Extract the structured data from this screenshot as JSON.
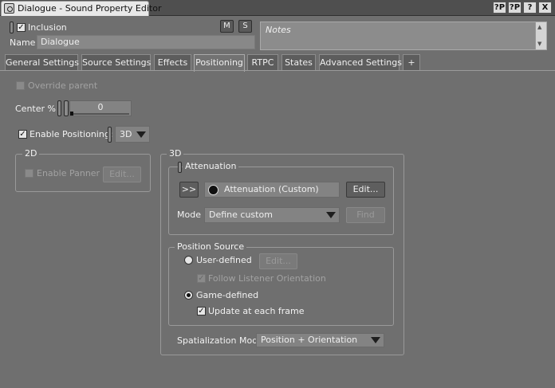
{
  "window": {
    "title": "Dialogue - Sound Property Editor",
    "controls": [
      "?P",
      "?P",
      "?",
      "X"
    ]
  },
  "header": {
    "inclusion_label": "Inclusion",
    "inclusion_checked": true,
    "mute_label": "M",
    "solo_label": "S",
    "name_label": "Name",
    "name_value": "Dialogue",
    "notes_placeholder": "Notes"
  },
  "tabs": [
    {
      "label": "General Settings",
      "active": false
    },
    {
      "label": "Source Settings",
      "active": false
    },
    {
      "label": "Effects",
      "active": false
    },
    {
      "label": "Positioning",
      "active": true
    },
    {
      "label": "RTPC",
      "active": false
    },
    {
      "label": "States",
      "active": false
    },
    {
      "label": "Advanced Settings",
      "active": false
    },
    {
      "label": "+",
      "active": false
    }
  ],
  "positioning": {
    "override_parent_label": "Override parent",
    "center_label": "Center %",
    "center_value": "0",
    "enable_positioning_label": "Enable Positioning:",
    "enable_positioning_checked": true,
    "mode_value": "3D",
    "group_2d": {
      "title": "2D",
      "enable_panner_label": "Enable Panner",
      "edit_label": "Edit..."
    },
    "group_3d": {
      "title": "3D",
      "attenuation": {
        "title": "Attenuation",
        "arrow_label": ">>",
        "attenuation_value": "Attenuation (Custom)",
        "edit_label": "Edit...",
        "mode_label": "Mode",
        "mode_value": "Define custom",
        "find_label": "Find"
      },
      "position_source": {
        "title": "Position Source",
        "user_defined_label": "User-defined",
        "edit_label": "Edit...",
        "follow_listener_label": "Follow Listener Orientation",
        "game_defined_label": "Game-defined",
        "game_defined_selected": true,
        "update_each_frame_label": "Update at each frame",
        "update_each_frame_checked": true
      },
      "spatialization_label": "Spatialization Mode",
      "spatialization_value": "Position + Orientation"
    }
  }
}
